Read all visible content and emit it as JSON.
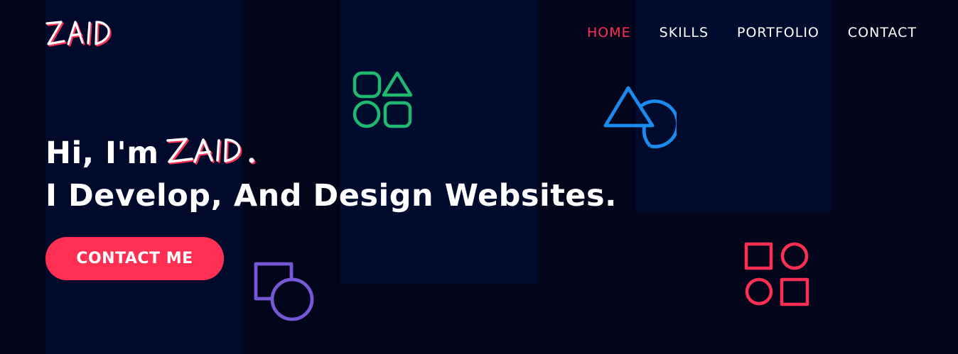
{
  "brand": {
    "logo_text": "ZAID"
  },
  "nav": {
    "items": [
      {
        "label": "HOME",
        "active": true
      },
      {
        "label": "SKILLS",
        "active": false
      },
      {
        "label": "PORTFOLIO",
        "active": false
      },
      {
        "label": "CONTACT",
        "active": false
      }
    ]
  },
  "hero": {
    "greeting": "Hi, I'm",
    "name": "ZAID.",
    "tagline": "I Develop, And Design Websites."
  },
  "cta": {
    "label": "CONTACT ME"
  },
  "decor": {
    "icons": [
      "shapes-icon",
      "triangle-circle-icon",
      "square-circle-icon",
      "shapes-grid-icon"
    ]
  },
  "colors": {
    "background": "#03051a",
    "panel": "#020a2c",
    "accent": "#ff2e53",
    "green": "#1fb96f",
    "blue": "#1a8cf0",
    "purple": "#7657d6",
    "red": "#ff2e53",
    "text": "#ffffff"
  }
}
